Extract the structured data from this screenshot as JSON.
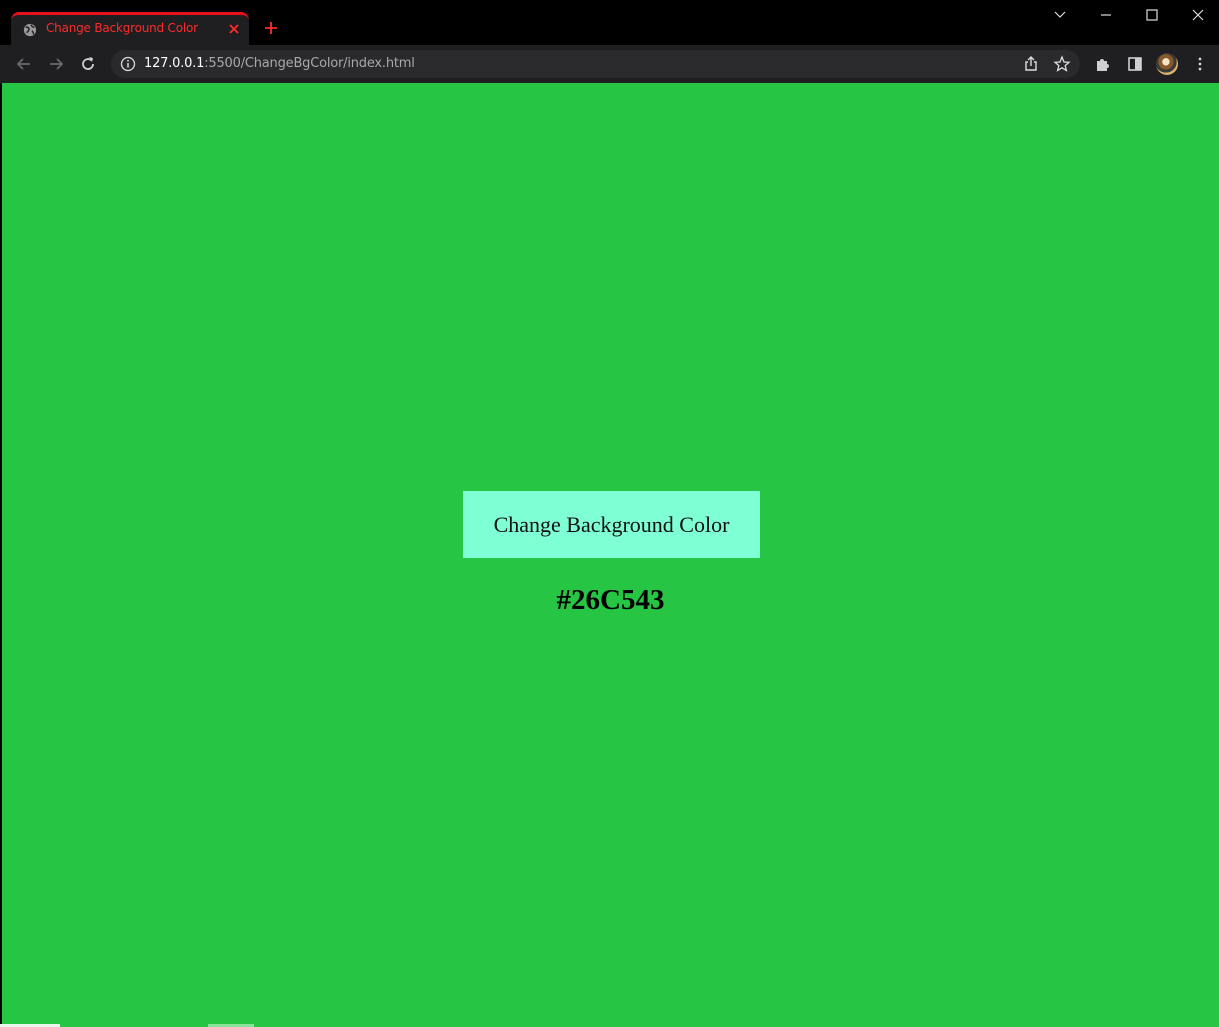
{
  "browser": {
    "tab": {
      "title": "Change Background Color",
      "icon": "globe-icon",
      "accent": "#e8101c"
    },
    "url": {
      "host": "127.0.0.1",
      "rest": ":5500/ChangeBgColor/index.html"
    }
  },
  "page": {
    "background_color": "#26C543",
    "button": {
      "label": "Change Background Color",
      "color": "#7FFFD4"
    },
    "hex_text": "#26C543"
  }
}
